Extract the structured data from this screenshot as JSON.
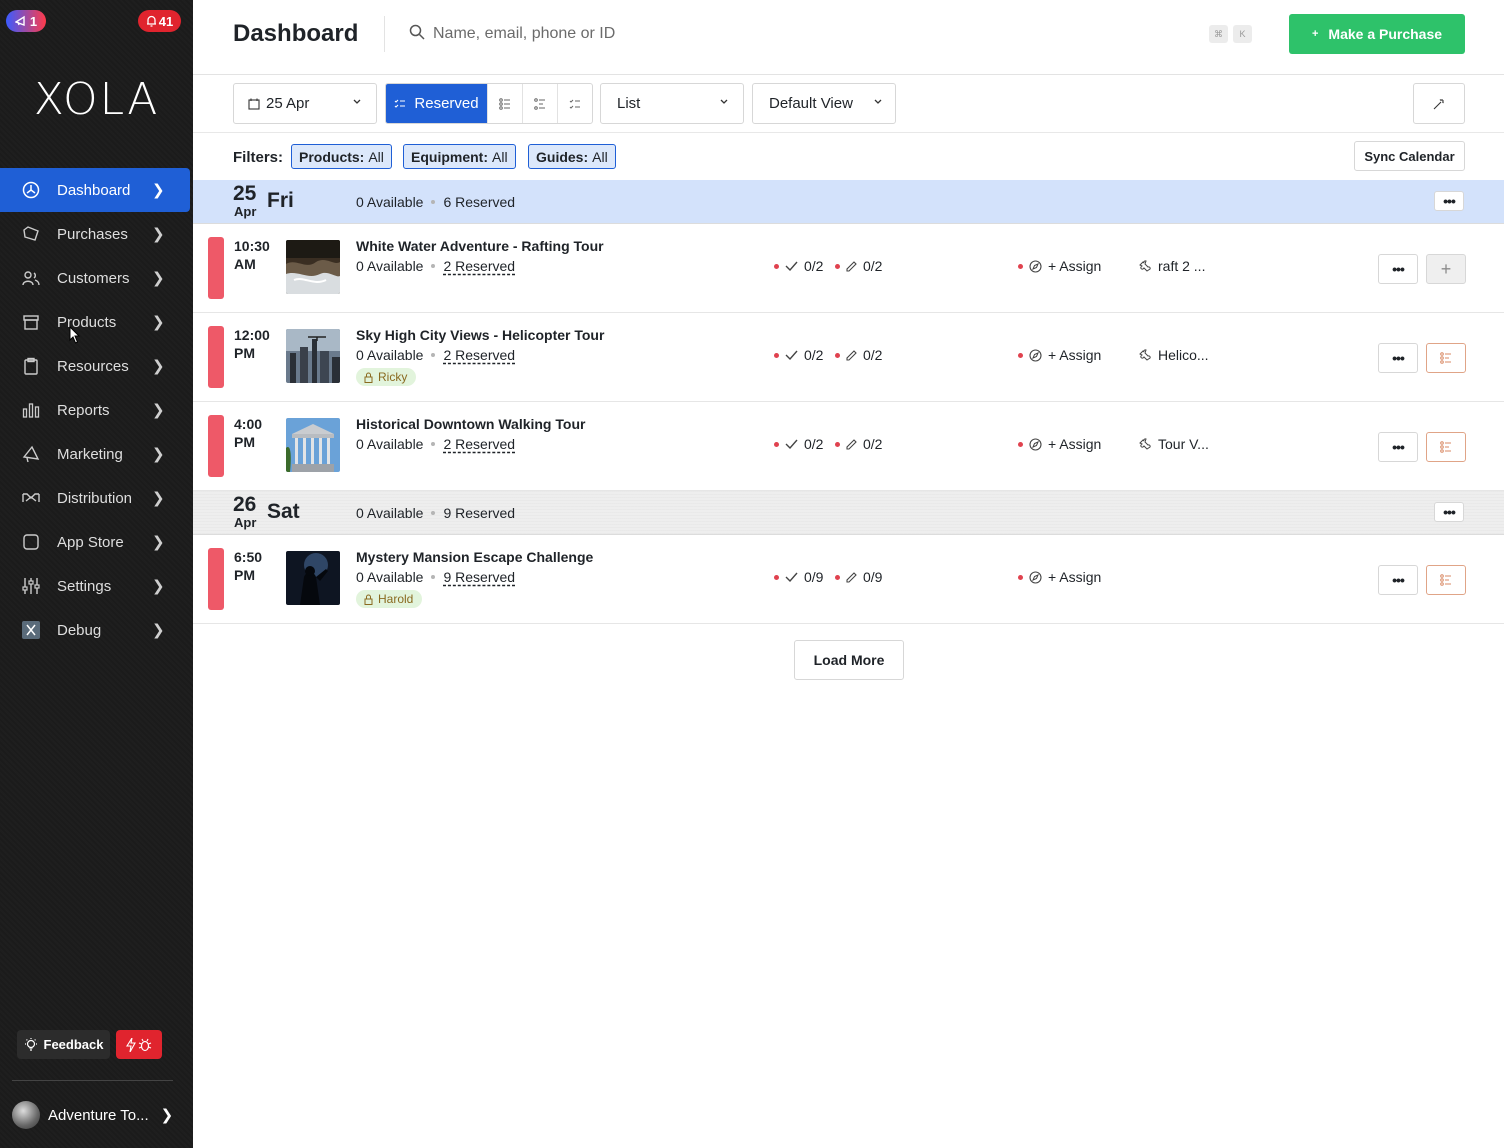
{
  "sidebar": {
    "badge_left": "1",
    "badge_right": "41",
    "logo": "XOLA",
    "items": [
      {
        "label": "Dashboard",
        "icon": "dashboard-icon"
      },
      {
        "label": "Purchases",
        "icon": "tag-icon"
      },
      {
        "label": "Customers",
        "icon": "users-icon"
      },
      {
        "label": "Products",
        "icon": "box-icon"
      },
      {
        "label": "Resources",
        "icon": "clipboard-icon"
      },
      {
        "label": "Reports",
        "icon": "bar-chart-icon"
      },
      {
        "label": "Marketing",
        "icon": "megaphone-icon"
      },
      {
        "label": "Distribution",
        "icon": "handshake-icon"
      },
      {
        "label": "App Store",
        "icon": "square-icon"
      },
      {
        "label": "Settings",
        "icon": "sliders-icon"
      },
      {
        "label": "Debug",
        "icon": "debug-x-icon"
      }
    ],
    "feedback_label": "Feedback",
    "account_name": "Adventure To..."
  },
  "header": {
    "title": "Dashboard",
    "search_placeholder": "Name, email, phone or ID",
    "kbd_1": "⌘",
    "kbd_2": "K",
    "purchase_label": "Make a Purchase"
  },
  "toolbar": {
    "date": "25 Apr",
    "mode_active": "Reserved",
    "layout": "List",
    "view": "Default View"
  },
  "filters": {
    "label": "Filters:",
    "chips": [
      {
        "name": "Products:",
        "value": "All"
      },
      {
        "name": "Equipment:",
        "value": "All"
      },
      {
        "name": "Guides:",
        "value": "All"
      }
    ],
    "sync_label": "Sync Calendar"
  },
  "days": [
    {
      "num": "25",
      "mon": "Apr",
      "dow": "Fri",
      "available": "0 Available",
      "reserved": "6 Reserved"
    },
    {
      "num": "26",
      "mon": "Apr",
      "dow": "Sat",
      "available": "0 Available",
      "reserved": "9 Reserved"
    }
  ],
  "events": [
    {
      "time_1": "10:30",
      "time_2": "AM",
      "title": "White Water Adventure - Rafting Tour",
      "available": "0 Available",
      "reserved": "2 Reserved",
      "checkin": "0/2",
      "waiver": "0/2",
      "assign": "+ Assign",
      "resource": "raft 2 ...",
      "guide": ""
    },
    {
      "time_1": "12:00",
      "time_2": "PM",
      "title": "Sky High City Views - Helicopter Tour",
      "available": "0 Available",
      "reserved": "2 Reserved",
      "checkin": "0/2",
      "waiver": "0/2",
      "assign": "+ Assign",
      "resource": "Helico...",
      "guide": "Ricky"
    },
    {
      "time_1": "4:00",
      "time_2": "PM",
      "title": "Historical Downtown Walking Tour",
      "available": "0 Available",
      "reserved": "2 Reserved",
      "checkin": "0/2",
      "waiver": "0/2",
      "assign": "+ Assign",
      "resource": "Tour V...",
      "guide": ""
    },
    {
      "time_1": "6:50",
      "time_2": "PM",
      "title": "Mystery Mansion Escape Challenge",
      "available": "0 Available",
      "reserved": "9 Reserved",
      "checkin": "0/9",
      "waiver": "0/9",
      "assign": "+ Assign",
      "resource": "",
      "guide": "Harold"
    }
  ],
  "load_more_label": "Load More",
  "colors": {
    "sidebar_bg": "#1b1b1b",
    "accent_blue": "#1f5fd6",
    "purchase_green": "#2ec26a",
    "status_red": "#ee5968",
    "badge_red": "#e0242e",
    "day_header_blue": "#d3e2fb"
  }
}
